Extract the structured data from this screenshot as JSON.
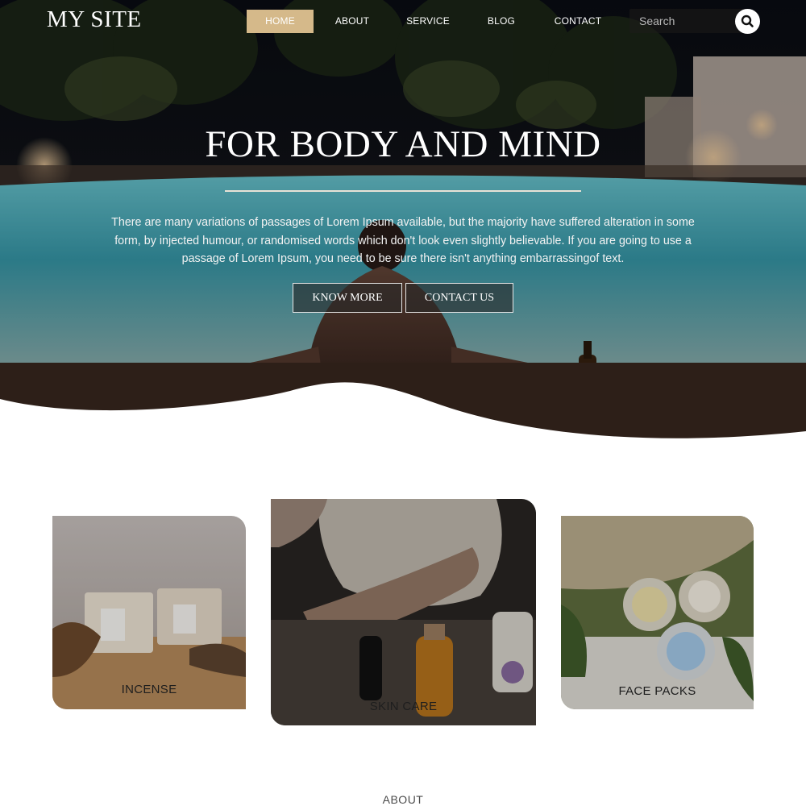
{
  "header": {
    "logo": "MY SITE",
    "nav": [
      {
        "label": "HOME",
        "active": true
      },
      {
        "label": "ABOUT",
        "active": false
      },
      {
        "label": "SERVICE",
        "active": false
      },
      {
        "label": "BLOG",
        "active": false
      },
      {
        "label": "CONTACT",
        "active": false
      }
    ],
    "search": {
      "placeholder": "Search",
      "value": "",
      "icon": "search-icon"
    }
  },
  "hero": {
    "title": "FOR BODY AND MIND",
    "text": "There are many variations of passages of Lorem Ipsum available, but the majority have suffered alteration in some form, by injected humour, or randomised words which don't look even slightly believable. If you are going to use a passage of Lorem Ipsum, you need to be sure there isn't anything embarrassingof text.",
    "buttons": {
      "know_more": "KNOW MORE",
      "contact_us": "CONTACT US"
    }
  },
  "cards": [
    {
      "label": "INCENSE"
    },
    {
      "label": "SKIN CARE"
    },
    {
      "label": "FACE PACKS"
    }
  ],
  "about": {
    "heading": "ABOUT"
  },
  "colors": {
    "accent": "#d5b98a",
    "pool": "#4fb5c4",
    "night": "#0c1018"
  }
}
